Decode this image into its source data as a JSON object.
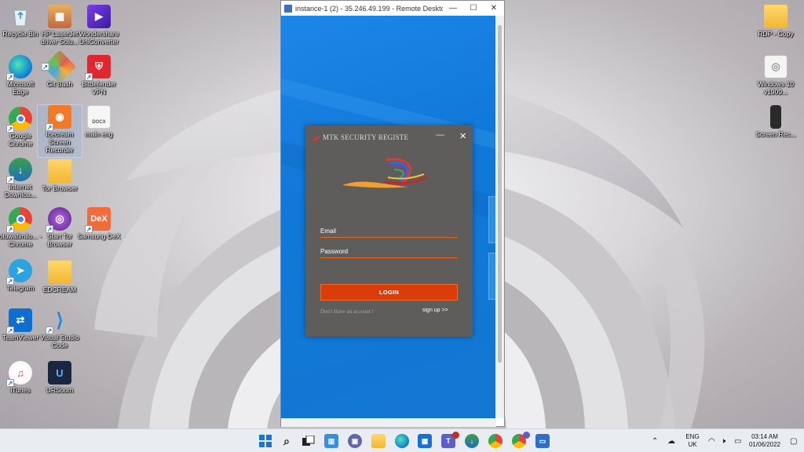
{
  "desktop": {
    "icons": [
      {
        "id": "recycle",
        "label": "Recycle Bin"
      },
      {
        "id": "hp",
        "label": "HP LaserJet driver Solu..."
      },
      {
        "id": "wondershare",
        "label": "Wondershare UniConverter"
      },
      {
        "id": "edge",
        "label": "Microsoft Edge"
      },
      {
        "id": "git",
        "label": "Git Bash"
      },
      {
        "id": "bitdefender",
        "label": "Bitdefender VPN"
      },
      {
        "id": "chrome",
        "label": "Google Chrome"
      },
      {
        "id": "icecream",
        "label": "Icecream Screen Recorder"
      },
      {
        "id": "docx",
        "label": "main eng"
      },
      {
        "id": "idm",
        "label": "Internet Downloa..."
      },
      {
        "id": "torfolder",
        "label": "Tor Browser"
      },
      {
        "id": "chrome2",
        "label": "oluwafimilo... - Chrome"
      },
      {
        "id": "tor",
        "label": "Start Tor Browser"
      },
      {
        "id": "dex",
        "label": "Samsung DeX"
      },
      {
        "id": "telegram",
        "label": "Telegram"
      },
      {
        "id": "folder2",
        "label": "EDCREAM"
      },
      {
        "id": "teamviewer",
        "label": "TeamViewer"
      },
      {
        "id": "vscode",
        "label": "Visual Studio Code"
      },
      {
        "id": "itunes",
        "label": "iTunes"
      },
      {
        "id": "ursoom",
        "label": "URSoom"
      },
      {
        "id": "rdpcopy",
        "label": "RDP - Copy"
      },
      {
        "id": "win10",
        "label": "Windows 10 v1909..."
      },
      {
        "id": "screenrec",
        "label": "Screen Rec..."
      }
    ],
    "icon_texts": {
      "docx": "DOCX",
      "dex": "DeX"
    }
  },
  "rdp_window": {
    "title": "instance-1 (2) - 35.246.49.199 - Remote Deskto...",
    "minimize": "—",
    "maximize": "☐",
    "close": "✕"
  },
  "app": {
    "title": "MTK SECURITY REGISTE",
    "minimize": "—",
    "close": "✕",
    "email_label": "Email",
    "password_label": "Password",
    "login_label": "LOGIN",
    "no_account": "Don't Have an account !",
    "signup": "sign up >>"
  },
  "taskbar": {
    "badges": {
      "teams": "",
      "store": "",
      "chrome": ""
    },
    "lang_top": "ENG",
    "lang_bottom": "UK",
    "time": "03:14 AM",
    "date": "01/06/2022"
  }
}
